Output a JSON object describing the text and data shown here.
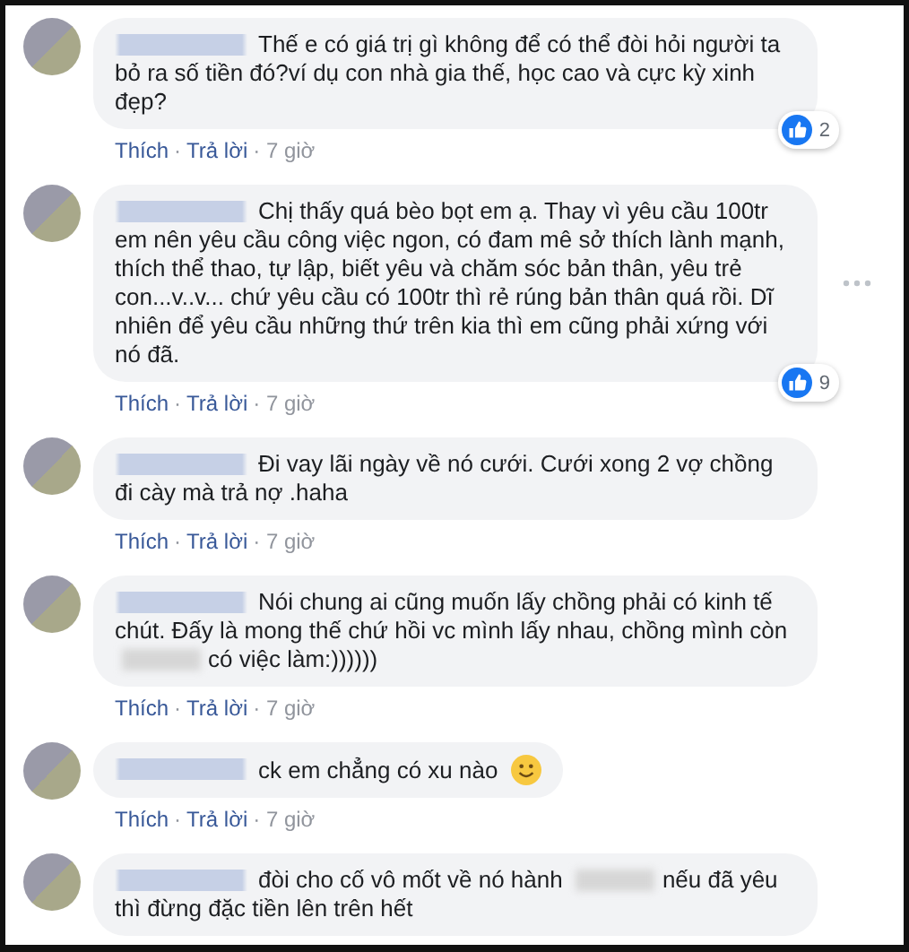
{
  "comments": [
    {
      "segments": [
        {
          "kind": "text",
          "text": "Thế e có giá trị gì không để có thể đòi hỏi người ta bỏ ra số tiền đó?ví dụ con nhà gia thế, học cao và cực kỳ xinh đẹp?"
        }
      ],
      "reactions": "2",
      "menu_visible": false,
      "actions": [
        {
          "kind": "link",
          "text": "Thích"
        },
        {
          "kind": "sep",
          "text": "·"
        },
        {
          "kind": "link",
          "text": "Trả lời"
        },
        {
          "kind": "sep",
          "text": "· 7 giờ"
        }
      ]
    },
    {
      "segments": [
        {
          "kind": "text",
          "text": "Chị thấy quá bèo bọt em ạ. Thay vì yêu cầu 100tr em nên yêu cầu công việc ngon, có đam mê sở thích lành mạnh, thích thể thao, tự lập, biết yêu và chăm sóc bản thân, yêu trẻ con...v..v... chứ yêu cầu có 100tr thì rẻ rúng bản thân quá rồi. Dĩ nhiên để yêu cầu những thứ trên kia thì em cũng phải xứng với nó đã."
        }
      ],
      "reactions": "9",
      "menu_visible": true,
      "actions": [
        {
          "kind": "link",
          "text": "Thích"
        },
        {
          "kind": "sep",
          "text": "·"
        },
        {
          "kind": "link",
          "text": "Trả lời"
        },
        {
          "kind": "sep",
          "text": "· 7 giờ"
        }
      ]
    },
    {
      "segments": [
        {
          "kind": "text",
          "text": "Đi vay lãi ngày về nó cưới. Cưới xong 2 vợ chồng đi cày mà trả nợ .haha"
        }
      ],
      "menu_visible": false,
      "actions": [
        {
          "kind": "link",
          "text": "Thích"
        },
        {
          "kind": "sep",
          "text": "·"
        },
        {
          "kind": "link",
          "text": "Trả lời"
        },
        {
          "kind": "sep",
          "text": "· 7 giờ"
        }
      ]
    },
    {
      "segments": [
        {
          "kind": "text",
          "text": "Nói chung ai cũng muốn lấy chồng phải có kinh tế chút. Đấy là mong thế chứ hồi vc mình lấy nhau, chồng mình còn"
        },
        {
          "kind": "redacted"
        },
        {
          "kind": "text",
          "text": "có việc làm:))))))"
        }
      ],
      "menu_visible": false,
      "actions": [
        {
          "kind": "link",
          "text": "Thích"
        },
        {
          "kind": "sep",
          "text": "·"
        },
        {
          "kind": "link",
          "text": "Trả lời"
        },
        {
          "kind": "sep",
          "text": "· 7 giờ"
        }
      ]
    },
    {
      "segments": [
        {
          "kind": "text",
          "text": "ck em chẳng có xu nào"
        },
        {
          "kind": "emoji"
        }
      ],
      "menu_visible": false,
      "actions": [
        {
          "kind": "link",
          "text": "Thích"
        },
        {
          "kind": "sep",
          "text": "·"
        },
        {
          "kind": "link",
          "text": "Trả lời"
        },
        {
          "kind": "sep",
          "text": "· 7 giờ"
        }
      ]
    },
    {
      "segments": [
        {
          "kind": "text",
          "text": "đòi cho cố vô mốt về nó hành"
        },
        {
          "kind": "redacted"
        },
        {
          "kind": "text",
          "text": "nếu đã yêu thì đừng đặc tiền lên trên hết"
        }
      ],
      "menu_visible": false
    }
  ]
}
